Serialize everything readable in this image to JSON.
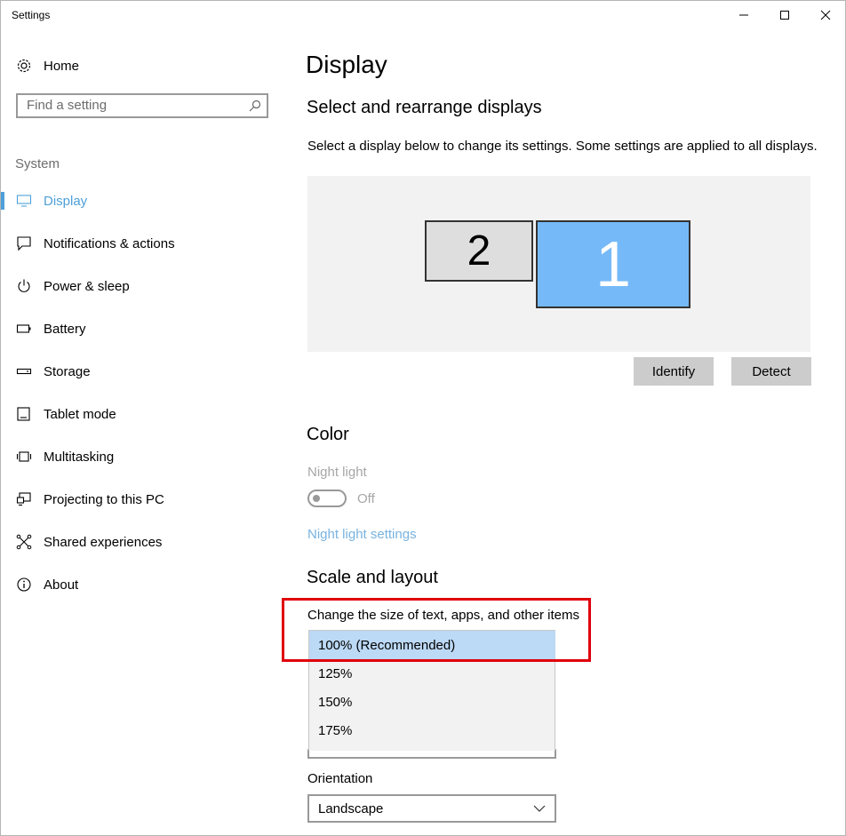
{
  "window": {
    "title": "Settings"
  },
  "sidebar": {
    "home_label": "Home",
    "search_placeholder": "Find a setting",
    "section_label": "System",
    "items": [
      {
        "label": "Display",
        "icon": "monitor-icon",
        "active": true
      },
      {
        "label": "Notifications & actions",
        "icon": "notification-icon"
      },
      {
        "label": "Power & sleep",
        "icon": "power-icon"
      },
      {
        "label": "Battery",
        "icon": "battery-icon"
      },
      {
        "label": "Storage",
        "icon": "storage-icon"
      },
      {
        "label": "Tablet mode",
        "icon": "tablet-icon"
      },
      {
        "label": "Multitasking",
        "icon": "multitasking-icon"
      },
      {
        "label": "Projecting to this PC",
        "icon": "projecting-icon"
      },
      {
        "label": "Shared experiences",
        "icon": "shared-icon"
      },
      {
        "label": "About",
        "icon": "info-icon"
      }
    ]
  },
  "main": {
    "title": "Display",
    "displays": {
      "heading": "Select and rearrange displays",
      "description": "Select a display below to change its settings. Some settings are applied to all displays.",
      "monitor_2": "2",
      "monitor_1": "1",
      "identify_label": "Identify",
      "detect_label": "Detect"
    },
    "color": {
      "heading": "Color",
      "night_light_label": "Night light",
      "night_light_state": "Off",
      "night_light_link": "Night light settings"
    },
    "scale": {
      "heading": "Scale and layout",
      "size_label": "Change the size of text, apps, and other items",
      "options": [
        "100% (Recommended)",
        "125%",
        "150%",
        "175%"
      ],
      "selected_index": 0
    },
    "orientation": {
      "label": "Orientation",
      "value": "Landscape"
    }
  },
  "colors": {
    "accent": "#4ea0d9",
    "monitor_1": "#76b9f8",
    "highlight_box": "#e0000b",
    "selected_option": "#bcd9f5"
  }
}
